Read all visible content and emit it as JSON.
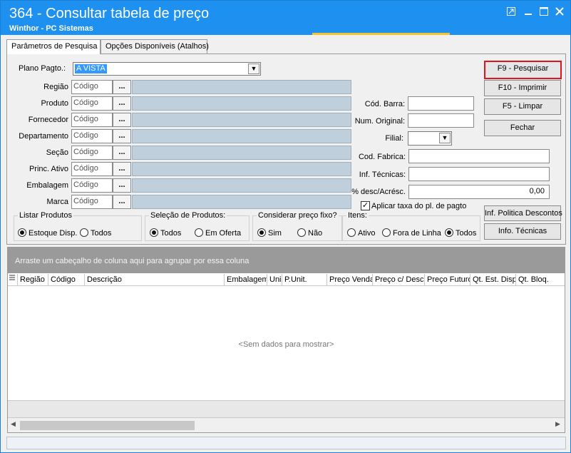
{
  "window": {
    "title": "364 - Consultar tabela de preço",
    "subtitle": "Winthor - PC Sistemas"
  },
  "tabs": [
    {
      "label": "Parâmetros de Pesquisa"
    },
    {
      "label": "Opções Disponíveis (Atalhos)"
    }
  ],
  "form": {
    "plano_label": "Plano Pagto.:",
    "plano_value": "A VISTA",
    "rows": [
      {
        "label": "Região",
        "placeholder": "Código"
      },
      {
        "label": "Produto",
        "placeholder": "Código"
      },
      {
        "label": "Fornecedor",
        "placeholder": "Código"
      },
      {
        "label": "Departamento",
        "placeholder": "Código"
      },
      {
        "label": "Seção",
        "placeholder": "Código"
      },
      {
        "label": "Princ. Ativo",
        "placeholder": "Código"
      },
      {
        "label": "Embalagem",
        "placeholder": "Código"
      },
      {
        "label": "Marca",
        "placeholder": "Código"
      }
    ],
    "dots_label": "...",
    "cod_barra_label": "Cód. Barra:",
    "num_original_label": "Num. Original:",
    "filial_label": "Filial:",
    "cod_fabrica_label": "Cod. Fabrica:",
    "inf_tecnicas_label": "Inf. Técnicas:",
    "desc_label": "% desc/Acrésc.",
    "desc_value": "0,00",
    "aplicar_label": "Aplicar taxa do pl. de pagto"
  },
  "buttons": {
    "pesquisar": "F9 - Pesquisar",
    "imprimir": "F10 - Imprimir",
    "limpar": "F5 - Limpar",
    "fechar": "Fechar",
    "politica": "Inf. Politica Descontos",
    "info_tecnicas": "Info. Técnicas"
  },
  "groups": {
    "listar": {
      "title": "Listar Produtos",
      "options": [
        "Estoque Disp.",
        "Todos"
      ]
    },
    "selecao": {
      "title": "Seleção de Produtos:",
      "options": [
        "Todos",
        "Em Oferta"
      ]
    },
    "considerar": {
      "title": "Considerar preço fixo?",
      "options": [
        "Sim",
        "Não"
      ]
    },
    "itens": {
      "title": "Itens:",
      "options": [
        "Ativo",
        "Fora de Linha",
        "Todos"
      ]
    }
  },
  "grid": {
    "group_hint": "Arraste um cabeçalho de coluna aqui para agrupar por essa coluna",
    "columns": [
      "Região",
      "Código",
      "Descrição",
      "Embalagem",
      "Uni",
      "P.Unit.",
      "Preço Venda",
      "Preço c/ Desc.",
      "Preço Futuro",
      "Qt. Est. Disp",
      "Qt. Bloq."
    ],
    "empty_text": "<Sem dados para mostrar>"
  },
  "icons": {
    "restore": "restore-icon",
    "minimize": "minimize-icon",
    "maximize": "maximize-icon",
    "close": "close-icon"
  }
}
